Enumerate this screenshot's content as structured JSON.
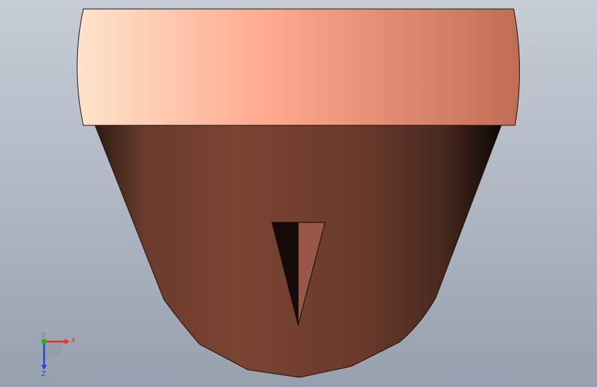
{
  "viewport": {
    "background_top": "#c6ccd5",
    "background_bottom": "#97a0ae"
  },
  "model": {
    "name": "tapered-cup-part",
    "rim_colors": [
      "#ffe3cc",
      "#ffa78c",
      "#c06d55"
    ],
    "body_colors": [
      "#2e1a14",
      "#7a4433",
      "#5a3327",
      "#0d0705"
    ],
    "slot_colors": [
      "#160b08",
      "#9a5646"
    ]
  },
  "triad": {
    "x_label": "X",
    "y_label": "Y",
    "z_label": "Z",
    "x_color": "#e8302a",
    "y_color": "#27b02a",
    "z_color": "#2b3bd6"
  }
}
